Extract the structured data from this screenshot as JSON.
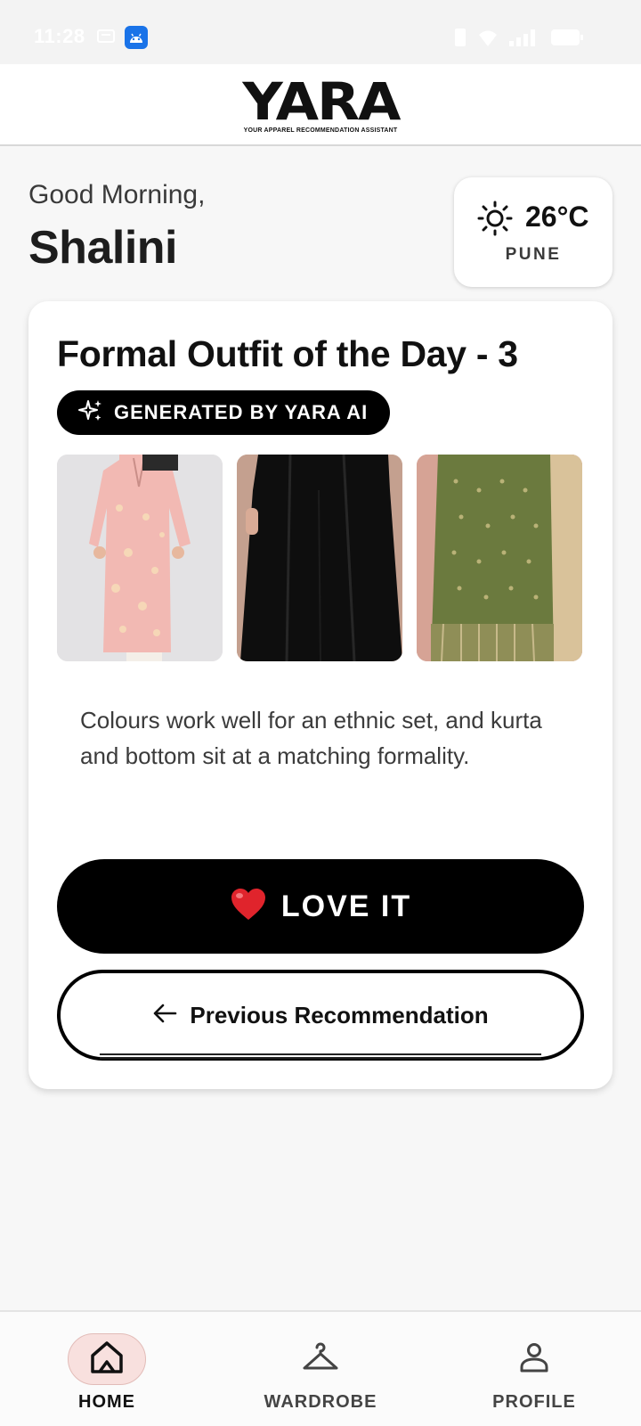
{
  "status_bar": {
    "time": "11:28"
  },
  "header": {
    "logo": "YARA",
    "tagline": "YOUR APPAREL RECOMMENDATION ASSISTANT"
  },
  "greeting": {
    "salutation": "Good Morning,",
    "name": "Shalini"
  },
  "weather": {
    "icon": "sun-icon",
    "temperature": "26°C",
    "city": "PUNE"
  },
  "outfit": {
    "title": "Formal Outfit of the Day - 3",
    "badge": "GENERATED BY YARA AI",
    "badge_icon": "sparkle-icon",
    "items": [
      {
        "kind": "kurta",
        "color": "#f2b9b3"
      },
      {
        "kind": "bottom",
        "color": "#111111"
      },
      {
        "kind": "dupatta",
        "color": "#6b7a3e"
      }
    ],
    "description": "Colours work well for an ethnic set, and kurta and bottom sit at a matching formality.",
    "love_button": {
      "emoji": "❤️",
      "label": "LOVE IT"
    },
    "previous_button": {
      "icon": "arrow-left-icon",
      "label": "Previous Recommendation"
    }
  },
  "nav": {
    "items": [
      {
        "label": "HOME",
        "icon": "home-icon",
        "active": true
      },
      {
        "label": "WARDROBE",
        "icon": "hanger-icon",
        "active": false
      },
      {
        "label": "PROFILE",
        "icon": "person-icon",
        "active": false
      }
    ]
  },
  "colors": {
    "accent": "#000000",
    "background": "#f7f7f7",
    "active_nav_bg": "#f8e0de"
  }
}
